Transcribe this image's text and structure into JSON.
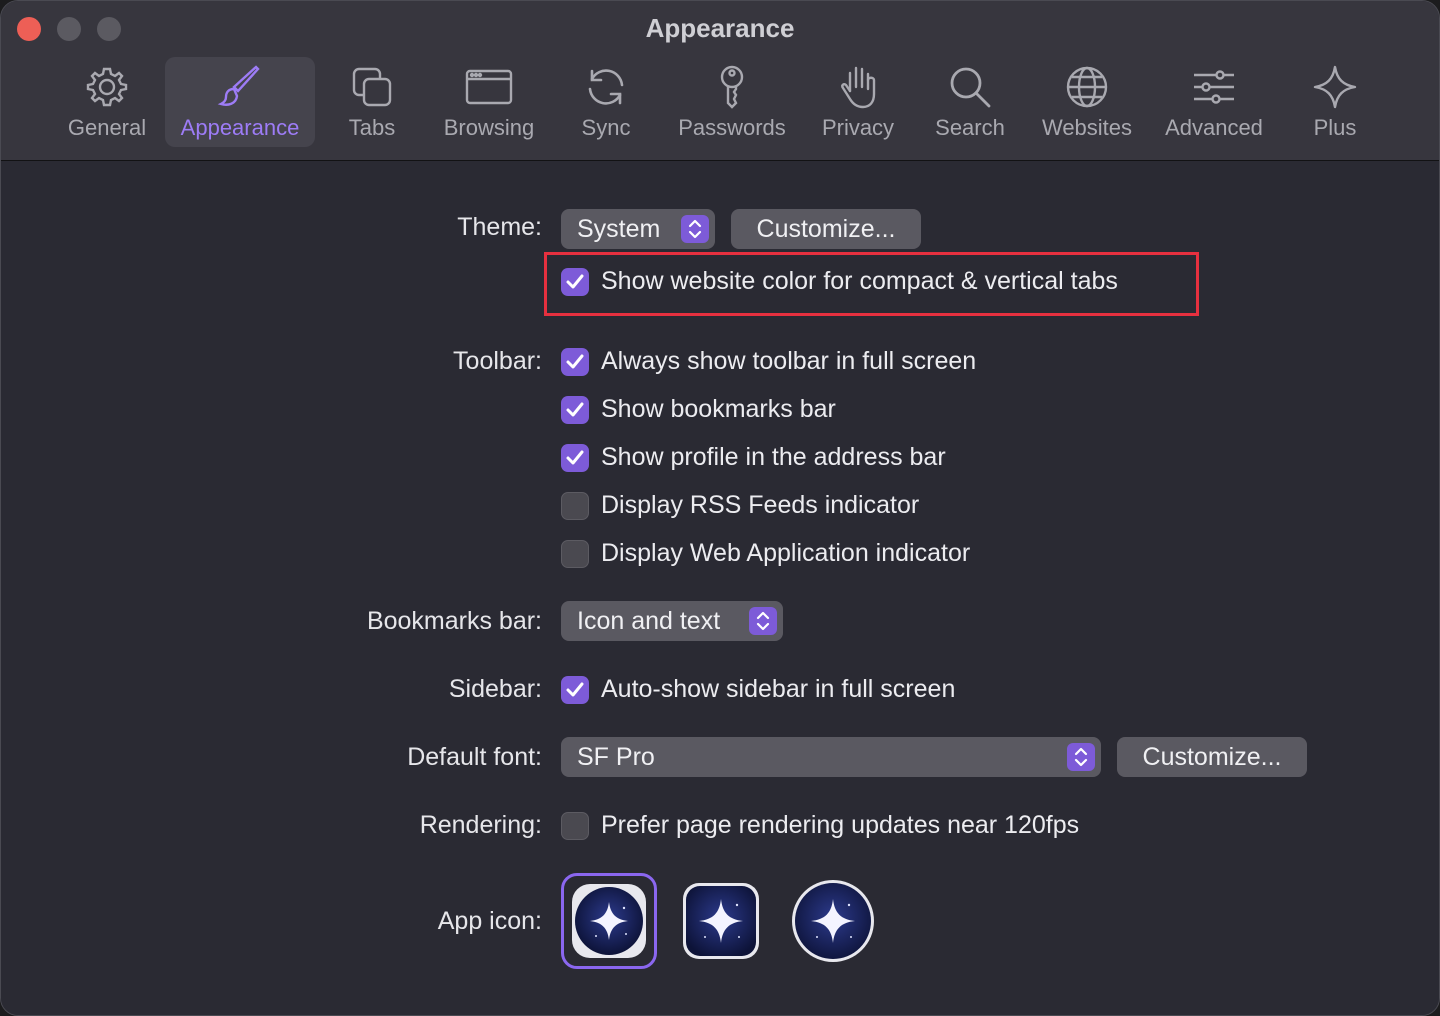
{
  "window": {
    "title": "Appearance"
  },
  "tabs": [
    {
      "id": "general",
      "label": "General",
      "icon": "gear-icon"
    },
    {
      "id": "appearance",
      "label": "Appearance",
      "icon": "paintbrush-icon",
      "active": true
    },
    {
      "id": "tabs",
      "label": "Tabs",
      "icon": "tabs-icon"
    },
    {
      "id": "browsing",
      "label": "Browsing",
      "icon": "browser-window-icon"
    },
    {
      "id": "sync",
      "label": "Sync",
      "icon": "sync-icon"
    },
    {
      "id": "passwords",
      "label": "Passwords",
      "icon": "key-icon"
    },
    {
      "id": "privacy",
      "label": "Privacy",
      "icon": "hand-icon"
    },
    {
      "id": "search",
      "label": "Search",
      "icon": "magnifier-icon"
    },
    {
      "id": "websites",
      "label": "Websites",
      "icon": "globe-icon"
    },
    {
      "id": "advanced",
      "label": "Advanced",
      "icon": "sliders-icon"
    },
    {
      "id": "plus",
      "label": "Plus",
      "icon": "sparkle-icon"
    }
  ],
  "theme": {
    "label": "Theme:",
    "value": "System",
    "customize_label": "Customize...",
    "website_color": {
      "label": "Show website color for compact & vertical tabs",
      "checked": true
    }
  },
  "toolbar": {
    "label": "Toolbar:",
    "options": [
      {
        "label": "Always show toolbar in full screen",
        "checked": true
      },
      {
        "label": "Show bookmarks bar",
        "checked": true
      },
      {
        "label": "Show profile in the address bar",
        "checked": true
      },
      {
        "label": "Display RSS Feeds indicator",
        "checked": false
      },
      {
        "label": "Display Web Application indicator",
        "checked": false
      }
    ]
  },
  "bookmarks_bar": {
    "label": "Bookmarks bar:",
    "value": "Icon and text"
  },
  "sidebar": {
    "label": "Sidebar:",
    "option": {
      "label": "Auto-show sidebar in full screen",
      "checked": true
    }
  },
  "default_font": {
    "label": "Default font:",
    "value": "SF Pro",
    "customize_label": "Customize..."
  },
  "rendering": {
    "label": "Rendering:",
    "option": {
      "label": "Prefer page rendering updates near 120fps",
      "checked": false
    }
  },
  "app_icon": {
    "label": "App icon:",
    "options": [
      "light-rounded-square",
      "dark-rounded-square",
      "dark-circle"
    ],
    "selected": 0
  },
  "colors": {
    "accent": "#7d5bd8",
    "active_tab_text": "#9d7cf6",
    "highlight": "#e6303f",
    "close": "#ed5f56"
  }
}
